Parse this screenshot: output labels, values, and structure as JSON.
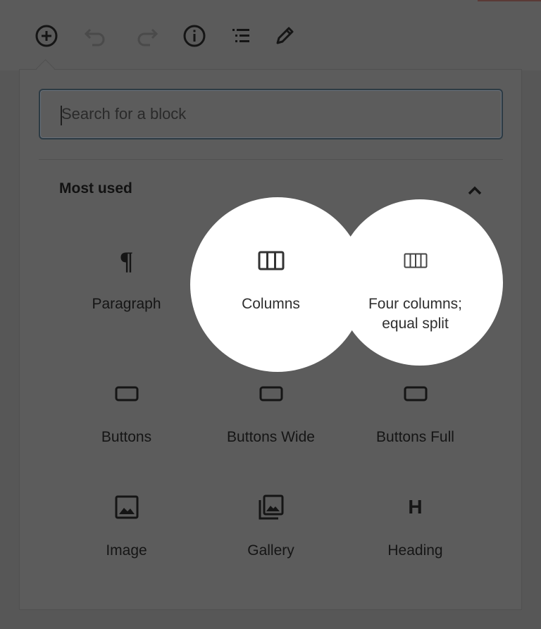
{
  "toolbar": {
    "items": [
      {
        "name": "add-block-icon"
      },
      {
        "name": "undo-icon"
      },
      {
        "name": "redo-icon"
      },
      {
        "name": "info-icon"
      },
      {
        "name": "outline-icon"
      },
      {
        "name": "edit-icon"
      }
    ]
  },
  "search": {
    "placeholder": "Search for a block",
    "value": ""
  },
  "section": {
    "title": "Most used",
    "collapse_icon": "chevron-up-icon"
  },
  "blocks": [
    {
      "label": "Paragraph",
      "icon": "paragraph-icon",
      "highlighted": false
    },
    {
      "label": "Columns",
      "icon": "columns-icon",
      "highlighted": true
    },
    {
      "label": "Four columns; equal split",
      "icon": "four-columns-icon",
      "highlighted": true
    },
    {
      "label": "Buttons",
      "icon": "button-icon",
      "highlighted": false
    },
    {
      "label": "Buttons Wide",
      "icon": "button-icon",
      "highlighted": false
    },
    {
      "label": "Buttons Full",
      "icon": "button-icon",
      "highlighted": false
    },
    {
      "label": "Image",
      "icon": "image-icon",
      "highlighted": false
    },
    {
      "label": "Gallery",
      "icon": "gallery-icon",
      "highlighted": false
    },
    {
      "label": "Heading",
      "icon": "heading-icon",
      "highlighted": false
    }
  ],
  "four_columns_label_lines": [
    "Four columns;",
    "equal split"
  ],
  "heading_icon_glyph": "H",
  "paragraph_icon_glyph": "¶",
  "colors": {
    "overlay": "#585858",
    "spotlight": "#ffffff",
    "search_border": "#2d3b44"
  }
}
